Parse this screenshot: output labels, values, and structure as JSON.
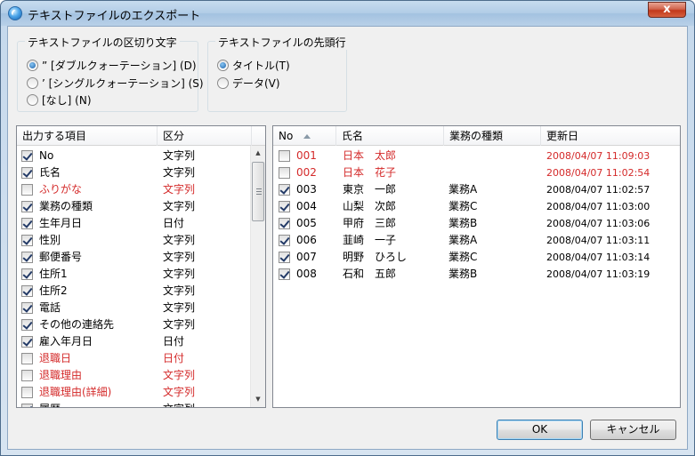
{
  "window": {
    "title": "テキストファイルのエクスポート",
    "close_glyph": "x"
  },
  "delimiter_group": {
    "title": "テキストファイルの区切り文字",
    "options": [
      {
        "label": "” [ダブルクォーテーション] (D)",
        "selected": true
      },
      {
        "label": "’ [シングルクォーテーション] (S)",
        "selected": false
      },
      {
        "label": "[なし] (N)",
        "selected": false
      }
    ]
  },
  "first_line_group": {
    "title": "テキストファイルの先頭行",
    "options": [
      {
        "label": "タイトル(T)",
        "selected": true
      },
      {
        "label": "データ(V)",
        "selected": false
      }
    ]
  },
  "fields_list": {
    "headers": {
      "item": "出力する項目",
      "type": "区分"
    },
    "rows": [
      {
        "name": "No",
        "type": "文字列",
        "checked": true,
        "red": false
      },
      {
        "name": "氏名",
        "type": "文字列",
        "checked": true,
        "red": false
      },
      {
        "name": "ふりがな",
        "type": "文字列",
        "checked": false,
        "red": true
      },
      {
        "name": "業務の種類",
        "type": "文字列",
        "checked": true,
        "red": false
      },
      {
        "name": "生年月日",
        "type": "日付",
        "checked": true,
        "red": false
      },
      {
        "name": "性別",
        "type": "文字列",
        "checked": true,
        "red": false
      },
      {
        "name": "郵便番号",
        "type": "文字列",
        "checked": true,
        "red": false
      },
      {
        "name": "住所1",
        "type": "文字列",
        "checked": true,
        "red": false
      },
      {
        "name": "住所2",
        "type": "文字列",
        "checked": true,
        "red": false
      },
      {
        "name": "電話",
        "type": "文字列",
        "checked": true,
        "red": false
      },
      {
        "name": "その他の連絡先",
        "type": "文字列",
        "checked": true,
        "red": false
      },
      {
        "name": "雇入年月日",
        "type": "日付",
        "checked": true,
        "red": false
      },
      {
        "name": "退職日",
        "type": "日付",
        "checked": false,
        "red": true
      },
      {
        "name": "退職理由",
        "type": "文字列",
        "checked": false,
        "red": true
      },
      {
        "name": "退職理由(詳細)",
        "type": "文字列",
        "checked": false,
        "red": true
      },
      {
        "name": "履歴",
        "type": "文字列",
        "checked": true,
        "red": false
      }
    ]
  },
  "records_list": {
    "headers": {
      "no": "No",
      "name": "氏名",
      "job": "業務の種類",
      "updated": "更新日"
    },
    "rows": [
      {
        "no": "001",
        "name": "日本　太郎",
        "job": "",
        "updated": "2008/04/07 11:09:03",
        "checked": false,
        "red": true
      },
      {
        "no": "002",
        "name": "日本　花子",
        "job": "",
        "updated": "2008/04/07 11:02:54",
        "checked": false,
        "red": true
      },
      {
        "no": "003",
        "name": "東京　一郎",
        "job": "業務A",
        "updated": "2008/04/07 11:02:57",
        "checked": true,
        "red": false
      },
      {
        "no": "004",
        "name": "山梨　次郎",
        "job": "業務C",
        "updated": "2008/04/07 11:03:00",
        "checked": true,
        "red": false
      },
      {
        "no": "005",
        "name": "甲府　三郎",
        "job": "業務B",
        "updated": "2008/04/07 11:03:06",
        "checked": true,
        "red": false
      },
      {
        "no": "006",
        "name": "韮崎　一子",
        "job": "業務A",
        "updated": "2008/04/07 11:03:11",
        "checked": true,
        "red": false
      },
      {
        "no": "007",
        "name": "明野　ひろし",
        "job": "業務C",
        "updated": "2008/04/07 11:03:14",
        "checked": true,
        "red": false
      },
      {
        "no": "008",
        "name": "石和　五郎",
        "job": "業務B",
        "updated": "2008/04/07 11:03:19",
        "checked": true,
        "red": false
      }
    ]
  },
  "buttons": {
    "ok": "OK",
    "cancel": "キャンセル"
  },
  "colors": {
    "excluded_text": "#d42a2a",
    "accent": "#3c7fb1"
  }
}
